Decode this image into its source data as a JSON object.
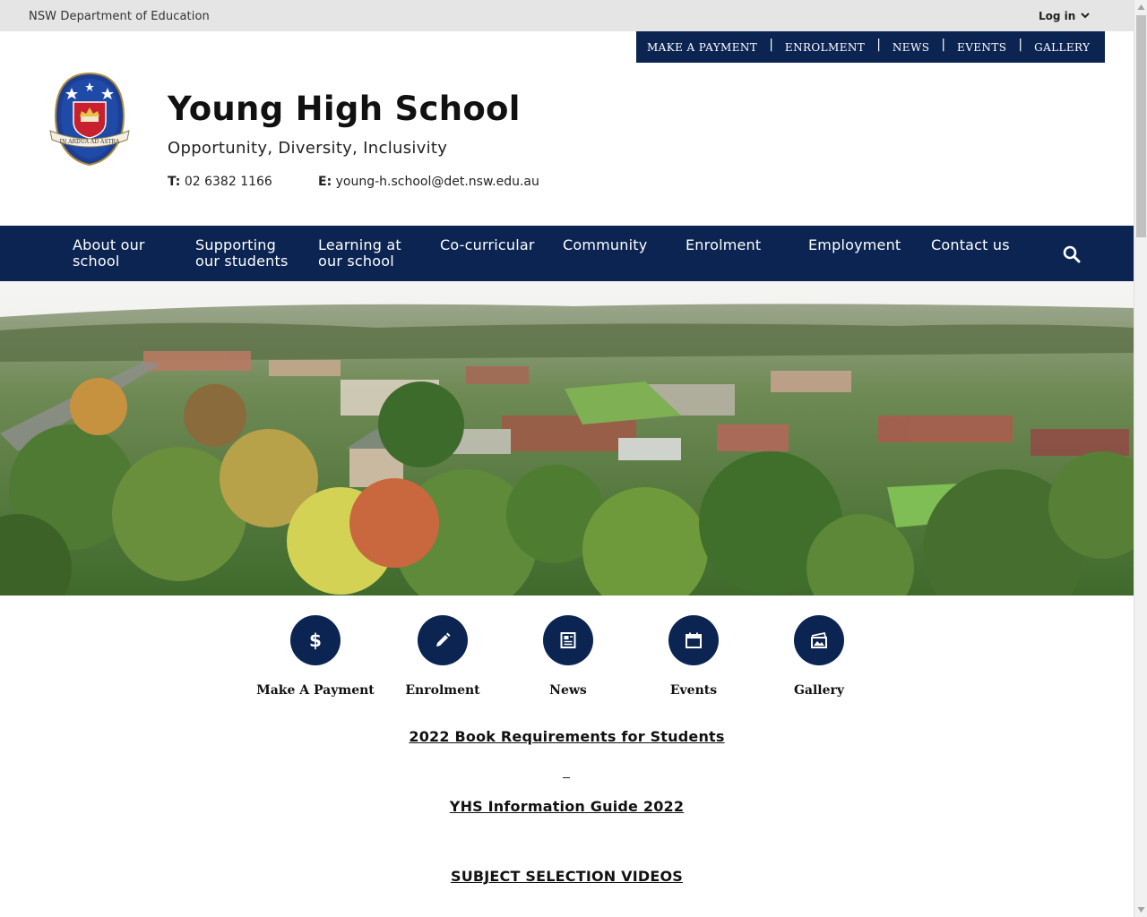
{
  "topbar": {
    "department": "NSW Department of Education",
    "login_label": "Log in"
  },
  "quick_links": [
    "MAKE A PAYMENT",
    "ENROLMENT",
    "NEWS",
    "EVENTS",
    "GALLERY"
  ],
  "header": {
    "school_name": "Young High School",
    "tagline": "Opportunity, Diversity, Inclusivity",
    "phone_label": "T:",
    "phone": "02 6382 1166",
    "email_label": "E:",
    "email": "young-h.school@det.nsw.edu.au",
    "crest_motto": "IN ARDUA AD ASTRA"
  },
  "nav": {
    "items": [
      "About our school",
      "Supporting our students",
      "Learning at our school",
      "Co-curricular",
      "Community",
      "Enrolment",
      "Employment",
      "Contact us"
    ],
    "search_icon": "search-icon"
  },
  "tiles": [
    {
      "label": "Make A Payment",
      "icon": "dollar-icon"
    },
    {
      "label": "Enrolment",
      "icon": "pencil-icon"
    },
    {
      "label": "News",
      "icon": "newspaper-icon"
    },
    {
      "label": "Events",
      "icon": "calendar-icon"
    },
    {
      "label": "Gallery",
      "icon": "gallery-icon"
    }
  ],
  "content_links": {
    "book_requirements": "2022 Book Requirements for Students",
    "info_guide": "YHS Information Guide 2022",
    "subject_videos": "SUBJECT SELECTION VIDEOS"
  },
  "colors": {
    "navy": "#0b2452",
    "topbar_grey": "#e5e5e5"
  }
}
